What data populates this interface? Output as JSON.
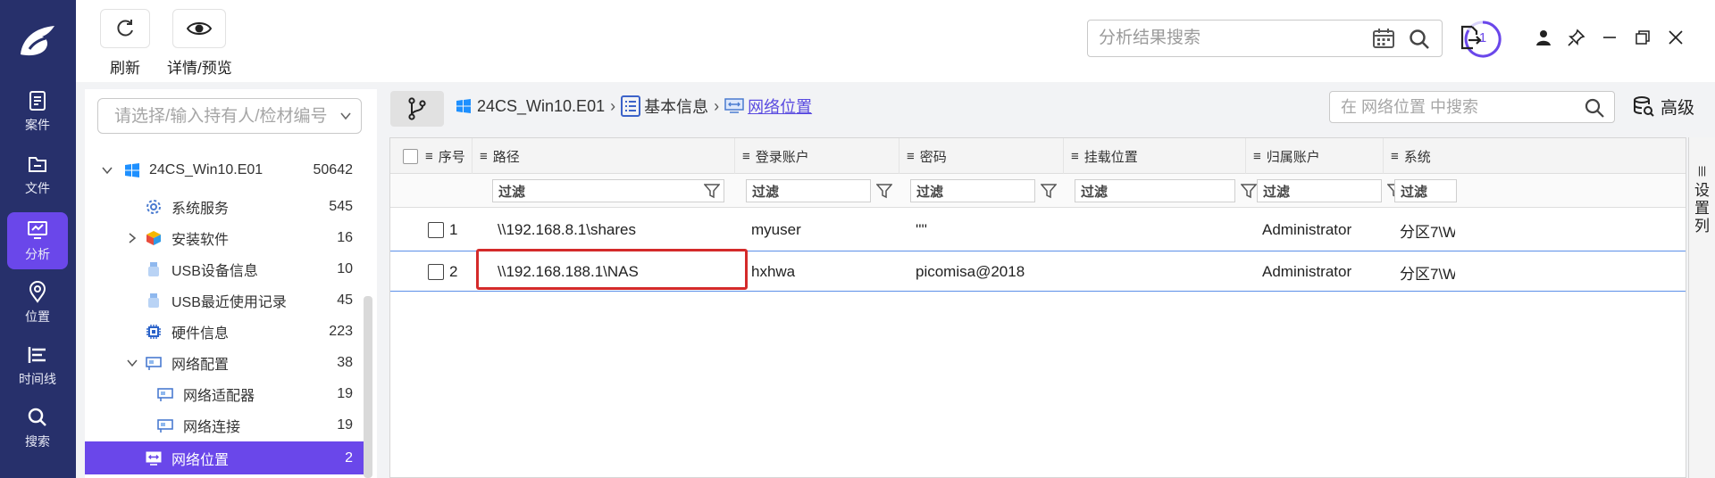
{
  "rail": {
    "items": [
      {
        "label": "案件"
      },
      {
        "label": "文件"
      },
      {
        "label": "分析"
      },
      {
        "label": "位置"
      },
      {
        "label": "时间线"
      },
      {
        "label": "搜索"
      }
    ],
    "active": "分析"
  },
  "toolbar": {
    "refresh_label": "刷新",
    "preview_label": "详情/预览",
    "search_placeholder": "分析结果搜索",
    "task_count": "1"
  },
  "tree": {
    "search_placeholder": "请选择/输入持有人/检材编号",
    "items": [
      {
        "label": "24CS_Win10.E01",
        "count": "50642"
      },
      {
        "label": "系统服务",
        "count": "545"
      },
      {
        "label": "安装软件",
        "count": "16"
      },
      {
        "label": "USB设备信息",
        "count": "10"
      },
      {
        "label": "USB最近使用记录",
        "count": "45"
      },
      {
        "label": "硬件信息",
        "count": "223"
      },
      {
        "label": "网络配置",
        "count": "38"
      },
      {
        "label": "网络适配器",
        "count": "19"
      },
      {
        "label": "网络连接",
        "count": "19"
      },
      {
        "label": "网络位置",
        "count": "2"
      }
    ]
  },
  "breadcrumb": {
    "root": "24CS_Win10.E01",
    "middle": "基本信息",
    "current": "网络位置"
  },
  "table_search": {
    "placeholder": "在 网络位置 中搜索"
  },
  "advanced_label": "高级",
  "settings_col": [
    "设",
    "置",
    "列"
  ],
  "table": {
    "columns": [
      "序号",
      "路径",
      "登录账户",
      "密码",
      "挂载位置",
      "归属账户",
      "系统"
    ],
    "filter_label": "过滤",
    "rows": [
      {
        "idx": "1",
        "path": "\\\\192.168.8.1\\shares",
        "account": "myuser",
        "password": "''''",
        "mount": "",
        "owner": "Administrator",
        "system": "分区7\\W"
      },
      {
        "idx": "2",
        "path": "\\\\192.168.188.1\\NAS",
        "account": "hxhwa",
        "password": "picomisa@2018",
        "mount": "",
        "owner": "Administrator",
        "system": "分区7\\W"
      }
    ]
  },
  "colors": {
    "rail_bg": "#27306b",
    "accent": "#6a47ea",
    "highlight_border": "#d42a2a",
    "link": "#5a4be0"
  }
}
